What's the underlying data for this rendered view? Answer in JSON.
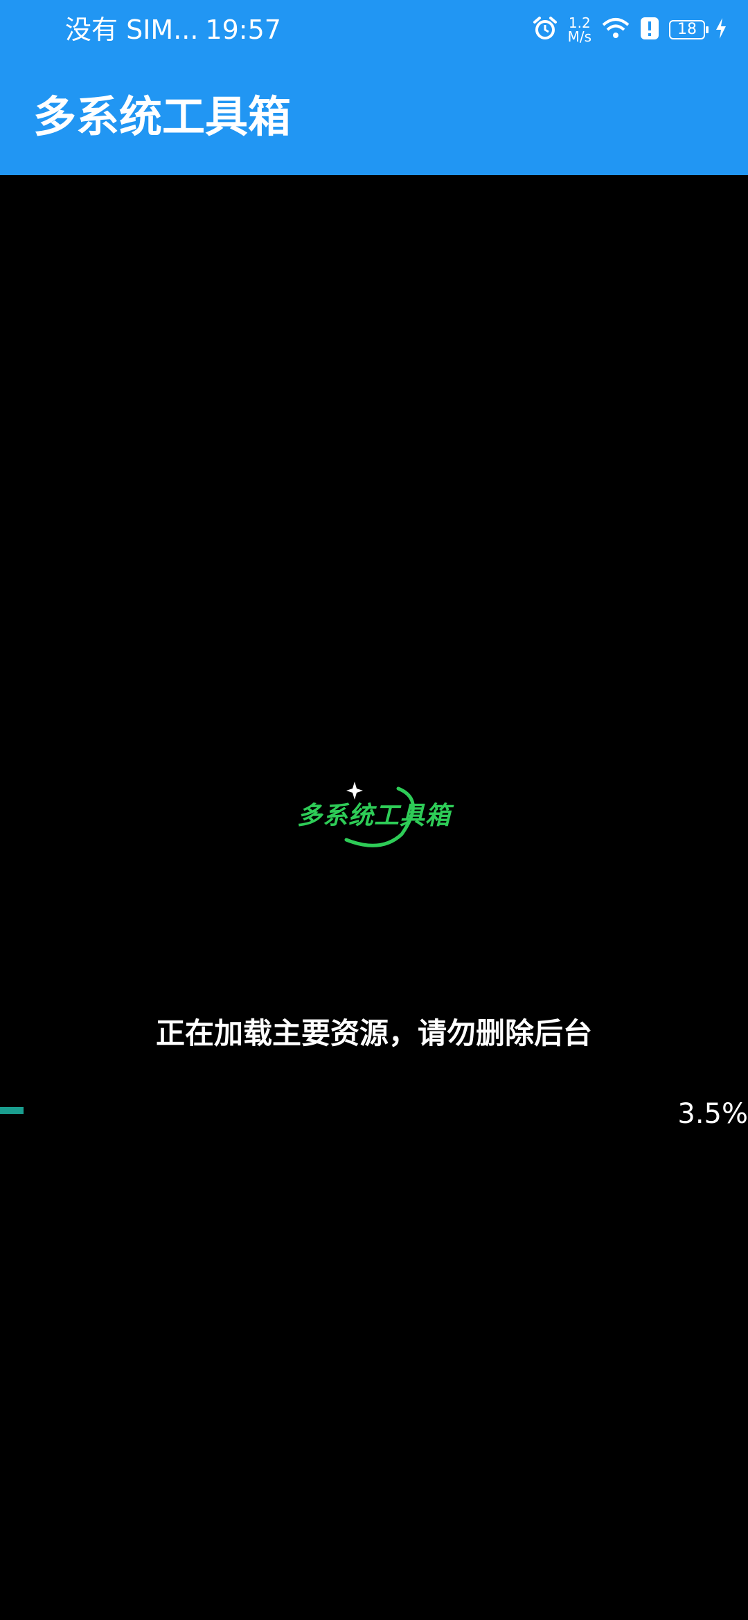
{
  "status_bar": {
    "carrier": "没有 SIM...",
    "time": "19:57",
    "speed_value": "1.2",
    "speed_unit": "M/s",
    "battery": "18",
    "icons": [
      "alarm-icon",
      "wifi-icon",
      "alert-icon",
      "battery-icon",
      "charging-icon"
    ]
  },
  "app_bar": {
    "title": "多系统工具箱"
  },
  "splash": {
    "logo_text": "多系统工具箱",
    "loading_message": "正在加载主要资源，请勿删除后台",
    "progress_fraction": 0.035,
    "progress_text": "3.5%"
  },
  "colors": {
    "app_bar": "#2196F3",
    "background": "#000000",
    "logo_green": "#2ecc57",
    "progress": "#1a9e8f"
  }
}
